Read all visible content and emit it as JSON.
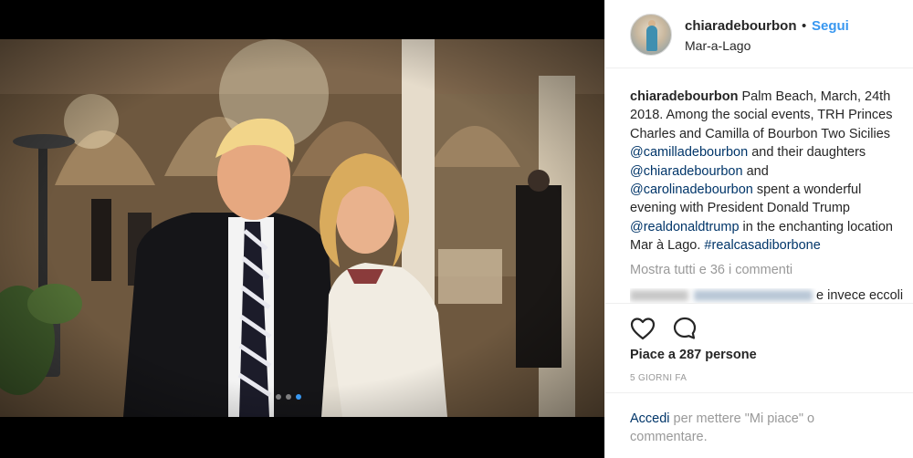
{
  "post": {
    "username": "chiaradebourbon",
    "separator": "•",
    "follow_label": "Segui",
    "location": "Mar-a-Lago"
  },
  "caption": {
    "username": "chiaradebourbon",
    "text_1": " Palm Beach, March, 24th 2018. Among the social events, TRH Princes Charles and Camilla of Bourbon Two Sicilies ",
    "mention_1": "@camilladebourbon",
    "text_2": " and their daughters ",
    "mention_2": "@chiaradebourbon",
    "text_3": " and ",
    "mention_3": "@carolinadebourbon",
    "text_4": " spent a wonderful evening with President Donald Trump ",
    "mention_4": "@realdonaldtrump",
    "text_5": " in the enchanting location Mar à Lago. ",
    "hashtag": "#realcasadiborbone"
  },
  "comments": {
    "view_all": "Mostra tutti e 36 i commenti",
    "partial_comment_text": "e invece eccoli"
  },
  "engagement": {
    "likes": "Piace a 287 persone",
    "date": "5 GIORNI FA"
  },
  "login_prompt": {
    "link": "Accedi",
    "text": " per mettere \"Mi piace\" o commentare."
  },
  "carousel": {
    "dot_count": 3,
    "active_index": 2
  },
  "icons": {
    "like": "heart-icon",
    "comment": "comment-icon"
  },
  "colors": {
    "link_blue": "#3897f0",
    "mention": "#003569",
    "muted": "#999999",
    "text": "#262626"
  }
}
